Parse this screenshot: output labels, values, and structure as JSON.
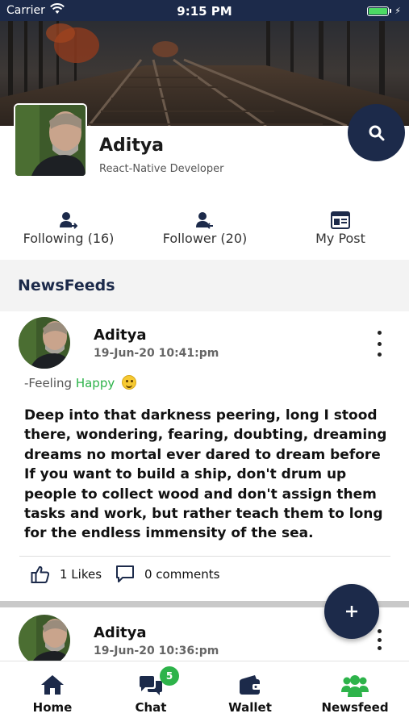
{
  "status_bar": {
    "carrier": "Carrier",
    "time": "9:15 PM"
  },
  "profile": {
    "name": "Aditya",
    "role": "React-Native Developer"
  },
  "stats": {
    "following": "Following (16)",
    "follower": "Follower (20)",
    "my_post": "My Post"
  },
  "section": {
    "title": "NewsFeeds"
  },
  "posts": [
    {
      "author": "Aditya",
      "timestamp": "19-Jun-20 10:41:pm",
      "feeling_prefix": "-Feeling",
      "feeling": "Happy",
      "text_lines": [
        "Deep into that darkness peering, long I stood there, wondering, fearing, doubting, dreaming dreams no mortal ever dared to dream before",
        "If you want to build a ship, don't drum up people to collect wood and don't assign them tasks and work, but rather teach them to long for the endless immensity of the sea."
      ],
      "likes": "1 Likes",
      "comments": "0 comments"
    },
    {
      "author": "Aditya",
      "timestamp": "19-Jun-20 10:36:pm"
    }
  ],
  "tabs": [
    {
      "label": "Home",
      "icon": "home-icon"
    },
    {
      "label": "Chat",
      "icon": "chat-icon",
      "badge": "5"
    },
    {
      "label": "Wallet",
      "icon": "wallet-icon"
    },
    {
      "label": "Newsfeed",
      "icon": "users-icon",
      "active": true
    }
  ],
  "colors": {
    "primary": "#1c2a4a",
    "accent": "#2db34a",
    "background": "#ffffff",
    "section_bg": "#f3f3f3"
  }
}
